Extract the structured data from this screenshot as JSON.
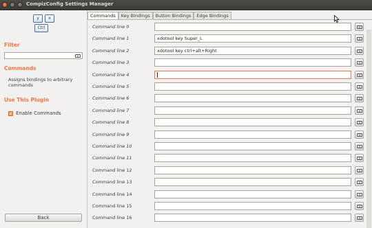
{
  "window": {
    "title": "CompizConfig Settings Manager"
  },
  "icon": {
    "key_y": "y",
    "key_x": "x",
    "key_ctrl": "Ctrl"
  },
  "left": {
    "filter_title": "Filter",
    "filter_value": "",
    "plugin_title": "Commands",
    "plugin_desc": "Assigns bindings to arbitrary commands",
    "use_title": "Use This Plugin",
    "enable_label": "Enable Commands",
    "enable_checked": true,
    "back_label": "Back"
  },
  "tabs": [
    {
      "label": "Commands",
      "active": true
    },
    {
      "label": "Key Bindings",
      "active": false
    },
    {
      "label": "Button Bindings",
      "active": false
    },
    {
      "label": "Edge Bindings",
      "active": false
    }
  ],
  "rows": [
    {
      "label": "Command line 0",
      "value": ""
    },
    {
      "label": "Command line 1",
      "value": "xdotool key Super_L"
    },
    {
      "label": "Command line 2",
      "value": "xdotool key ctrl+alt+Right"
    },
    {
      "label": "Command line 3",
      "value": ""
    },
    {
      "label": "Command line 4",
      "value": ""
    },
    {
      "label": "Command line 5",
      "value": ""
    },
    {
      "label": "Command line 6",
      "value": ""
    },
    {
      "label": "Command line 7",
      "value": ""
    },
    {
      "label": "Command line 8",
      "value": ""
    },
    {
      "label": "Command line 9",
      "value": ""
    },
    {
      "label": "Command line 10",
      "value": ""
    },
    {
      "label": "Command line 11",
      "value": ""
    },
    {
      "label": "Command line 12",
      "value": ""
    },
    {
      "label": "Command line 13",
      "value": ""
    },
    {
      "label": "Command line 14",
      "value": ""
    },
    {
      "label": "Command line 15",
      "value": ""
    },
    {
      "label": "Command line 16",
      "value": ""
    }
  ],
  "focused_row": 4,
  "colors": {
    "accent": "#f07746",
    "titlebar": "#3c3b37"
  }
}
